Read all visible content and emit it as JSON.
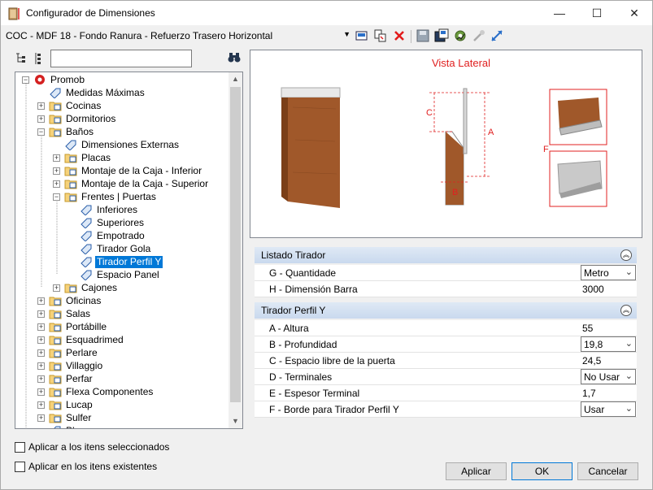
{
  "window": {
    "title": "Configurador de Dimensiones",
    "minimize": "—",
    "maximize": "☐",
    "close": "✕"
  },
  "toolbar": {
    "config_selector": "COC - MDF 18 - Fondo Ranura - Refuerzo Trasero Horizontal"
  },
  "search": {
    "value": ""
  },
  "tree": {
    "items": [
      {
        "label": "Promob"
      },
      {
        "label": "Medidas Máximas"
      },
      {
        "label": "Cocinas"
      },
      {
        "label": "Dormitorios"
      },
      {
        "label": "Baños"
      },
      {
        "label": "Dimensiones Externas"
      },
      {
        "label": "Placas"
      },
      {
        "label": "Montaje de la Caja - Inferior"
      },
      {
        "label": "Montaje de la Caja - Superior"
      },
      {
        "label": "Frentes | Puertas"
      },
      {
        "label": "Inferiores"
      },
      {
        "label": "Superiores"
      },
      {
        "label": "Empotrado"
      },
      {
        "label": "Tirador Gola"
      },
      {
        "label": "Tirador Perfil Y"
      },
      {
        "label": "Espacio Panel"
      },
      {
        "label": "Cajones"
      },
      {
        "label": "Oficinas"
      },
      {
        "label": "Salas"
      },
      {
        "label": "Portábille"
      },
      {
        "label": "Esquadrimed"
      },
      {
        "label": "Perlare"
      },
      {
        "label": "Villaggio"
      },
      {
        "label": "Perfar"
      },
      {
        "label": "Flexa Componentes"
      },
      {
        "label": "Lucap"
      },
      {
        "label": "Sulfer"
      },
      {
        "label": "Pl"
      }
    ]
  },
  "options": {
    "apply_selected": "Aplicar a los itens seleccionados",
    "apply_existing": "Aplicar en los itens existentes"
  },
  "preview": {
    "title": "Vista Lateral",
    "labels": {
      "a": "A",
      "b": "B",
      "c": "C",
      "f": "F"
    },
    "accent_color": "#e02020"
  },
  "sections": [
    {
      "title": "Listado Tirador",
      "rows": [
        {
          "name": "G - Quantidade",
          "value": "Metro"
        },
        {
          "name": "H - Dimensión Barra",
          "value": "3000"
        }
      ]
    },
    {
      "title": "Tirador Perfil Y",
      "rows": [
        {
          "name": "A - Altura",
          "value": "55"
        },
        {
          "name": "B - Profundidad",
          "value": "19,8"
        },
        {
          "name": "C - Espacio libre de la puerta",
          "value": "24,5"
        },
        {
          "name": "D - Terminales",
          "value": "No Usar"
        },
        {
          "name": "E - Espesor Terminal",
          "value": "1,7"
        },
        {
          "name": "F - Borde para Tirador Perfil Y",
          "value": "Usar"
        }
      ]
    }
  ],
  "buttons": {
    "apply": "Aplicar",
    "ok": "OK",
    "cancel": "Cancelar"
  }
}
